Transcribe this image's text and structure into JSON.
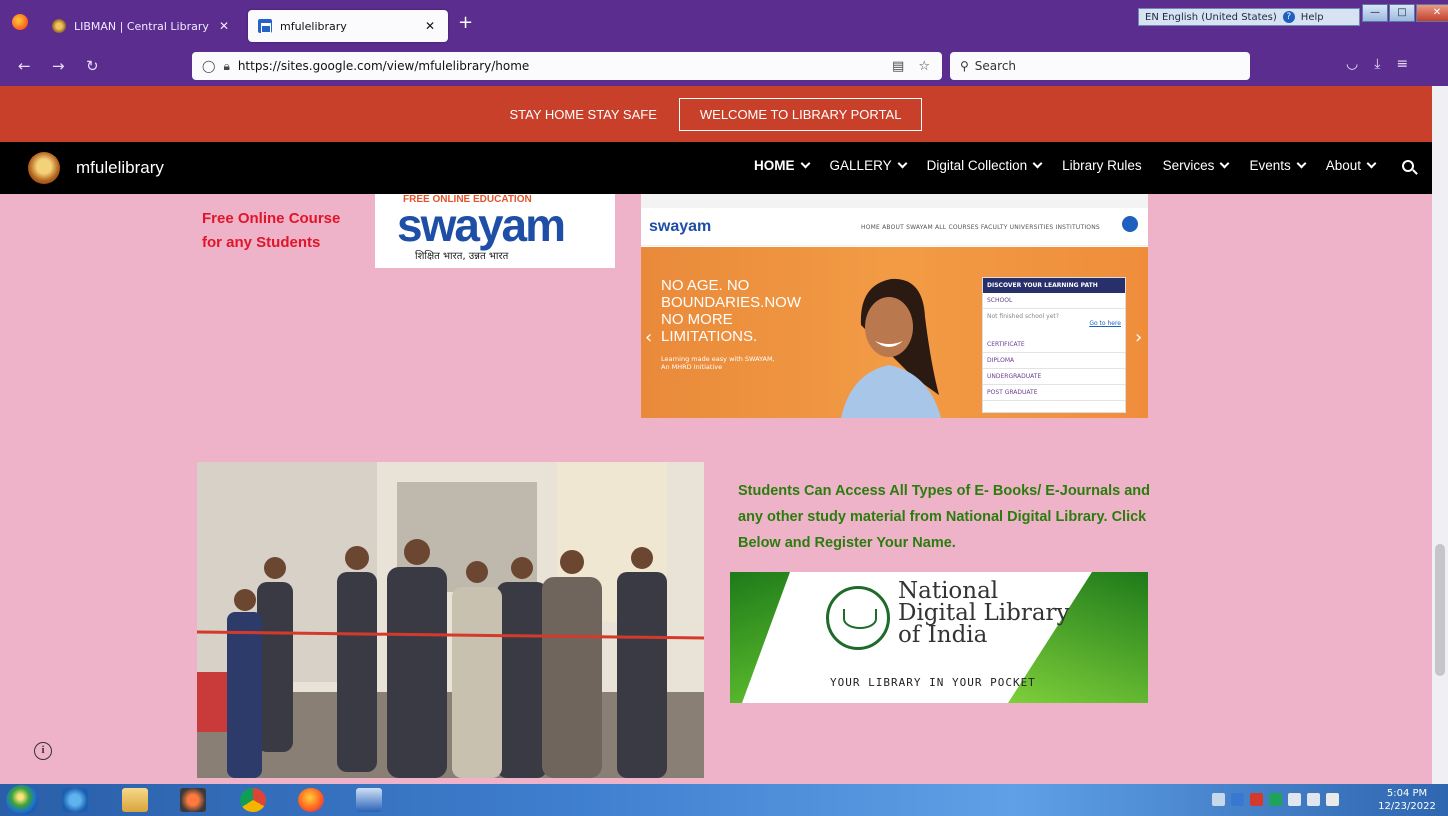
{
  "browser": {
    "tabs": [
      {
        "title": "LIBMAN | Central Library",
        "active": false
      },
      {
        "title": "mfulelibrary",
        "active": true
      }
    ],
    "new_tab_symbol": "+",
    "url": "https://sites.google.com/view/mfulelibrary/home",
    "search_placeholder": "Search",
    "language_bar": "EN English (United States)",
    "help_label": "Help"
  },
  "page": {
    "announcement_text": "STAY HOME STAY SAFE",
    "announcement_button": "WELCOME TO LIBRARY PORTAL",
    "site_name": "mfulelibrary",
    "menu": [
      {
        "label": "HOME",
        "dropdown": true,
        "active": true
      },
      {
        "label": "GALLERY",
        "dropdown": true
      },
      {
        "label": "Digital Collection",
        "dropdown": true
      },
      {
        "label": "Library Rules",
        "dropdown": false
      },
      {
        "label": "Services",
        "dropdown": true
      },
      {
        "label": "Events",
        "dropdown": true
      },
      {
        "label": "About",
        "dropdown": true
      }
    ],
    "free_course_text": "Free Online Course\nfor any Students",
    "swayam_logo": {
      "top_text": "FREE ONLINE EDUCATION",
      "word": "swayam",
      "tagline": "शिक्षित भारत, उन्नत भारत"
    },
    "swayam_screenshot": {
      "logo": "swayam",
      "menu": "HOME   ABOUT SWAYAM   ALL COURSES   FACULTY   UNIVERSITIES   INSTITUTIONS",
      "apps_label": "Apps",
      "headline": "NO AGE. NO\nBOUNDARIES.NOW\nNO MORE\nLIMITATIONS.",
      "subline": "Learning made easy with SWAYAM,\nAn MHRD Initiative",
      "panel_title": "DISCOVER YOUR LEARNING PATH",
      "panel_rows": [
        "SCHOOL",
        "CERTIFICATE",
        "DIPLOMA",
        "UNDERGRADUATE",
        "POST GRADUATE"
      ],
      "school_note": "Not finished school yet?",
      "school_link": "Go to here"
    },
    "ndl_text": "Students Can Access All Types of E- Books/ E-Journals and any other study material from National Digital Library. Click Below and Register Your Name.",
    "ndl_banner": {
      "title": "National\nDigital Library\nof India",
      "tagline": "YOUR LIBRARY IN YOUR POCKET"
    },
    "colors": {
      "page_bg": "#efb3c9",
      "announce_bg": "#c8402a",
      "nav_bg": "#000000",
      "free_course": "#e0152a",
      "ndl_text": "#2a7d0c"
    }
  },
  "taskbar": {
    "time": "5:04 PM",
    "date": "12/23/2022"
  }
}
